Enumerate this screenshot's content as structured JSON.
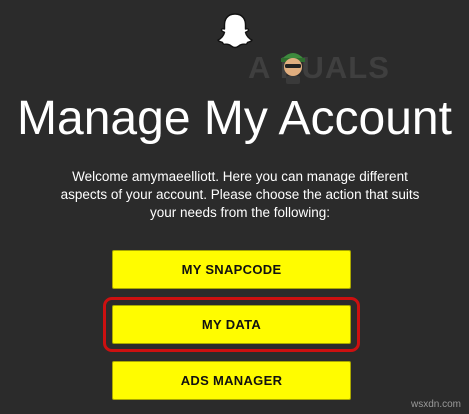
{
  "header": {
    "logo_icon": "snapchat-ghost-icon"
  },
  "watermark": {
    "text": "A PUALS",
    "mascot_icon": "appuals-mascot-icon"
  },
  "page": {
    "title": "Manage My Account",
    "intro": "Welcome amymaeelliott. Here you can manage different aspects of your account. Please choose the action that suits your needs from the following:"
  },
  "actions": {
    "snapcode_label": "MY SNAPCODE",
    "mydata_label": "MY DATA",
    "ads_label": "ADS MANAGER"
  },
  "colors": {
    "background": "#2b2b2b",
    "button": "#fffc00",
    "highlight": "#cc1010"
  },
  "footer": {
    "site": "wsxdn.com"
  }
}
